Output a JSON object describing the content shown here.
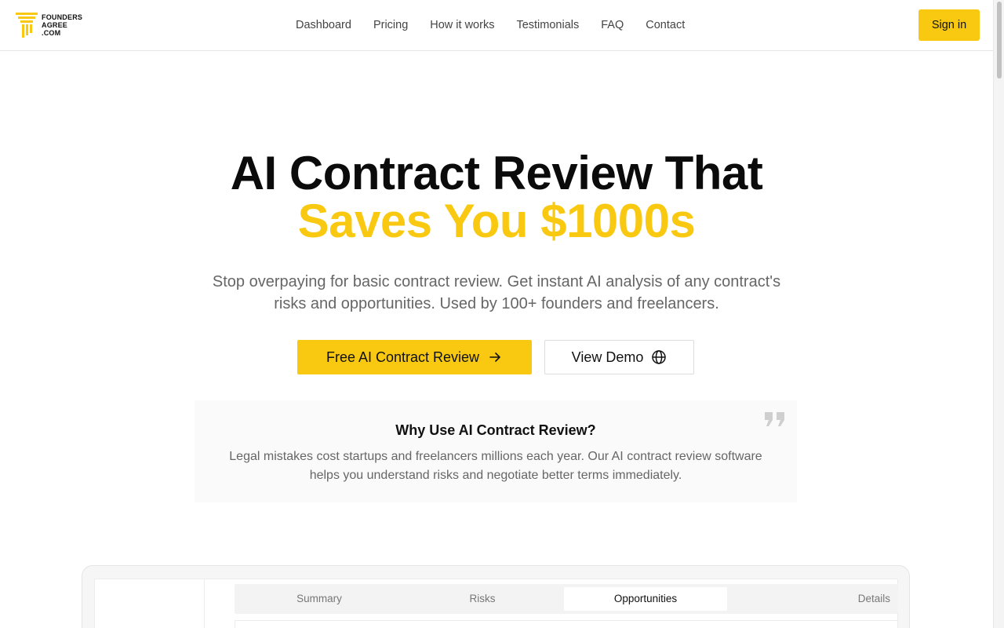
{
  "header": {
    "logo_lines": [
      "FOUNDERS",
      "AGREE",
      ".COM"
    ],
    "nav": [
      "Dashboard",
      "Pricing",
      "How it works",
      "Testimonials",
      "FAQ",
      "Contact"
    ],
    "signin_label": "Sign in"
  },
  "hero": {
    "title_line1": "AI Contract Review That",
    "title_line2": "Saves You $1000s",
    "subtitle": "Stop overpaying for basic contract review. Get instant AI analysis of any contract's risks and opportunities. Used by 100+ founders and freelancers.",
    "cta_primary": "Free AI Contract Review",
    "cta_primary_icon": "arrow-right-icon",
    "cta_secondary": "View Demo",
    "cta_secondary_icon": "globe-icon"
  },
  "why": {
    "title": "Why Use AI Contract Review?",
    "text": "Legal mistakes cost startups and freelancers millions each year. Our AI contract review software helps you understand risks and negotiate better terms immediately.",
    "icon": "quote-icon"
  },
  "preview": {
    "tabs": [
      "Summary",
      "Risks",
      "Opportunities",
      "Details"
    ],
    "active_tab": "Opportunities"
  },
  "colors": {
    "accent": "#f9c911",
    "text": "#111111",
    "muted": "#666666"
  }
}
